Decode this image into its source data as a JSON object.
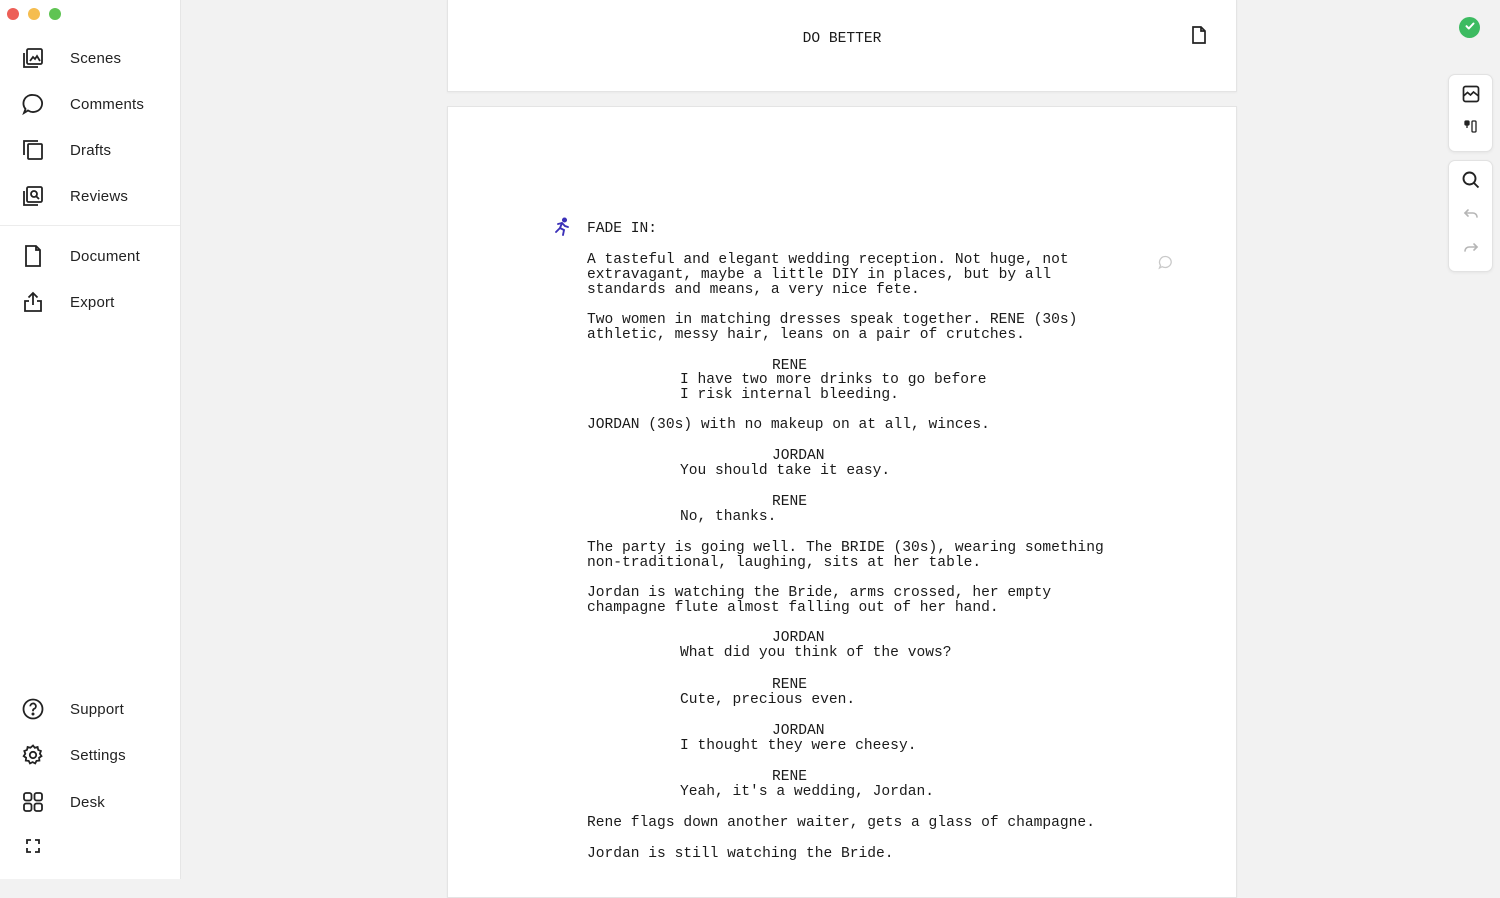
{
  "sidebar": {
    "items_top": [
      {
        "label": "Scenes"
      },
      {
        "label": "Comments"
      },
      {
        "label": "Drafts"
      },
      {
        "label": "Reviews"
      }
    ],
    "items_mid": [
      {
        "label": "Document"
      },
      {
        "label": "Export"
      }
    ],
    "items_bottom": [
      {
        "label": "Support"
      },
      {
        "label": "Settings"
      },
      {
        "label": "Desk"
      }
    ]
  },
  "title_page": {
    "title": "DO BETTER"
  },
  "script": {
    "lines": [
      "FADE IN:",
      "A tasteful and elegant wedding reception. Not huge, not",
      "extravagant, maybe a little DIY in places, but by all",
      "standards and means, a very nice fete.",
      "Two women in matching dresses speak together. RENE (30s)",
      "athletic, messy hair, leans on a pair of crutches.",
      "RENE",
      "I have two more drinks to go before",
      "I risk internal bleeding.",
      "JORDAN (30s) with no makeup on at all, winces.",
      "JORDAN",
      "You should take it easy.",
      "RENE",
      "No, thanks.",
      "The party is going well. The BRIDE (30s), wearing something",
      "non-traditional, laughing, sits at her table.",
      "Jordan is watching the Bride, arms crossed, her empty",
      "champagne flute almost falling out of her hand.",
      "JORDAN",
      "What did you think of the vows?",
      "RENE",
      "Cute, precious even.",
      "JORDAN",
      "I thought they were cheesy.",
      "RENE",
      "Yeah, it's a wedding, Jordan.",
      "Rene flags down another waiter, gets a glass of champagne.",
      "Jordan is still watching the Bride."
    ]
  },
  "colors": {
    "traffic_red": "#ed5f57",
    "traffic_yellow": "#f5bd4f",
    "traffic_green": "#5fc453",
    "status_green": "#3dbb61",
    "scene_marker": "#3b30b8"
  },
  "status": {
    "icon": "check-circle-icon"
  }
}
